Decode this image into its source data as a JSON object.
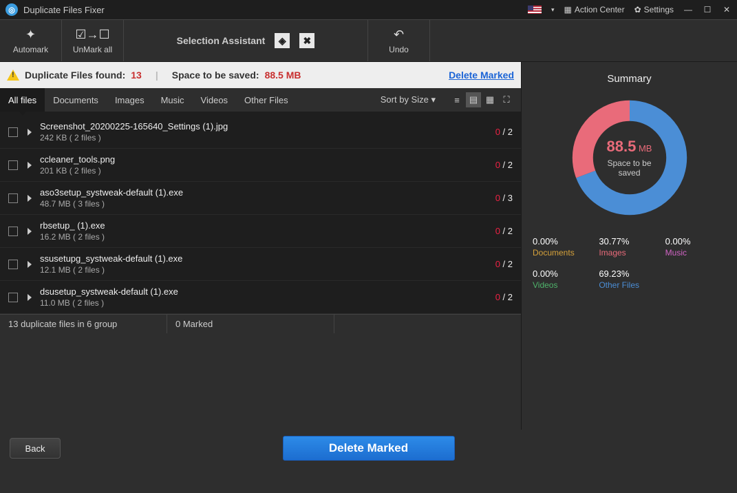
{
  "titleBar": {
    "appName": "Duplicate Files Fixer",
    "actionCenter": "Action Center",
    "settings": "Settings"
  },
  "toolbar": {
    "automark": "Automark",
    "unmarkAll": "UnMark all",
    "selectionAssistant": "Selection Assistant",
    "undo": "Undo"
  },
  "infoBar": {
    "dupFoundLabel": "Duplicate Files found:",
    "dupFoundCount": "13",
    "spaceLabel": "Space to be saved:",
    "spaceValue": "88.5 MB",
    "deleteMarked": "Delete Marked"
  },
  "tabs": [
    "All files",
    "Documents",
    "Images",
    "Music",
    "Videos",
    "Other Files"
  ],
  "sortLabel": "Sort by Size",
  "files": [
    {
      "name": "Screenshot_20200225-165640_Settings (1).jpg",
      "size": "242 KB  ( 2 files )",
      "marked": "0",
      "total": "2"
    },
    {
      "name": "ccleaner_tools.png",
      "size": "201 KB  ( 2 files )",
      "marked": "0",
      "total": "2"
    },
    {
      "name": "aso3setup_systweak-default (1).exe",
      "size": "48.7 MB  ( 3 files )",
      "marked": "0",
      "total": "3"
    },
    {
      "name": "rbsetup_ (1).exe",
      "size": "16.2 MB  ( 2 files )",
      "marked": "0",
      "total": "2"
    },
    {
      "name": "ssusetupg_systweak-default (1).exe",
      "size": "12.1 MB  ( 2 files )",
      "marked": "0",
      "total": "2"
    },
    {
      "name": "dsusetup_systweak-default (1).exe",
      "size": "11.0 MB  ( 2 files )",
      "marked": "0",
      "total": "2"
    }
  ],
  "statusBar": {
    "groupInfo": "13 duplicate files in 6 group",
    "markedInfo": "0 Marked"
  },
  "summary": {
    "title": "Summary",
    "value": "88.5",
    "unit": "MB",
    "label": "Space to be saved",
    "legend": [
      {
        "pct": "0.00%",
        "name": "Documents",
        "color": "#d6a23b"
      },
      {
        "pct": "30.77%",
        "name": "Images",
        "color": "#e96b7a"
      },
      {
        "pct": "0.00%",
        "name": "Music",
        "color": "#d064c4"
      },
      {
        "pct": "0.00%",
        "name": "Videos",
        "color": "#4fb36b"
      },
      {
        "pct": "69.23%",
        "name": "Other Files",
        "color": "#4b8ed6"
      }
    ]
  },
  "chart_data": {
    "type": "pie",
    "title": "Space to be saved",
    "series": [
      {
        "name": "Documents",
        "value": 0.0,
        "color": "#d6a23b"
      },
      {
        "name": "Images",
        "value": 30.77,
        "color": "#e96b7a"
      },
      {
        "name": "Music",
        "value": 0.0,
        "color": "#d064c4"
      },
      {
        "name": "Videos",
        "value": 0.0,
        "color": "#4fb36b"
      },
      {
        "name": "Other Files",
        "value": 69.23,
        "color": "#4b8ed6"
      }
    ],
    "total_label": "88.5 MB"
  },
  "bottom": {
    "back": "Back",
    "deleteMarked": "Delete Marked"
  }
}
